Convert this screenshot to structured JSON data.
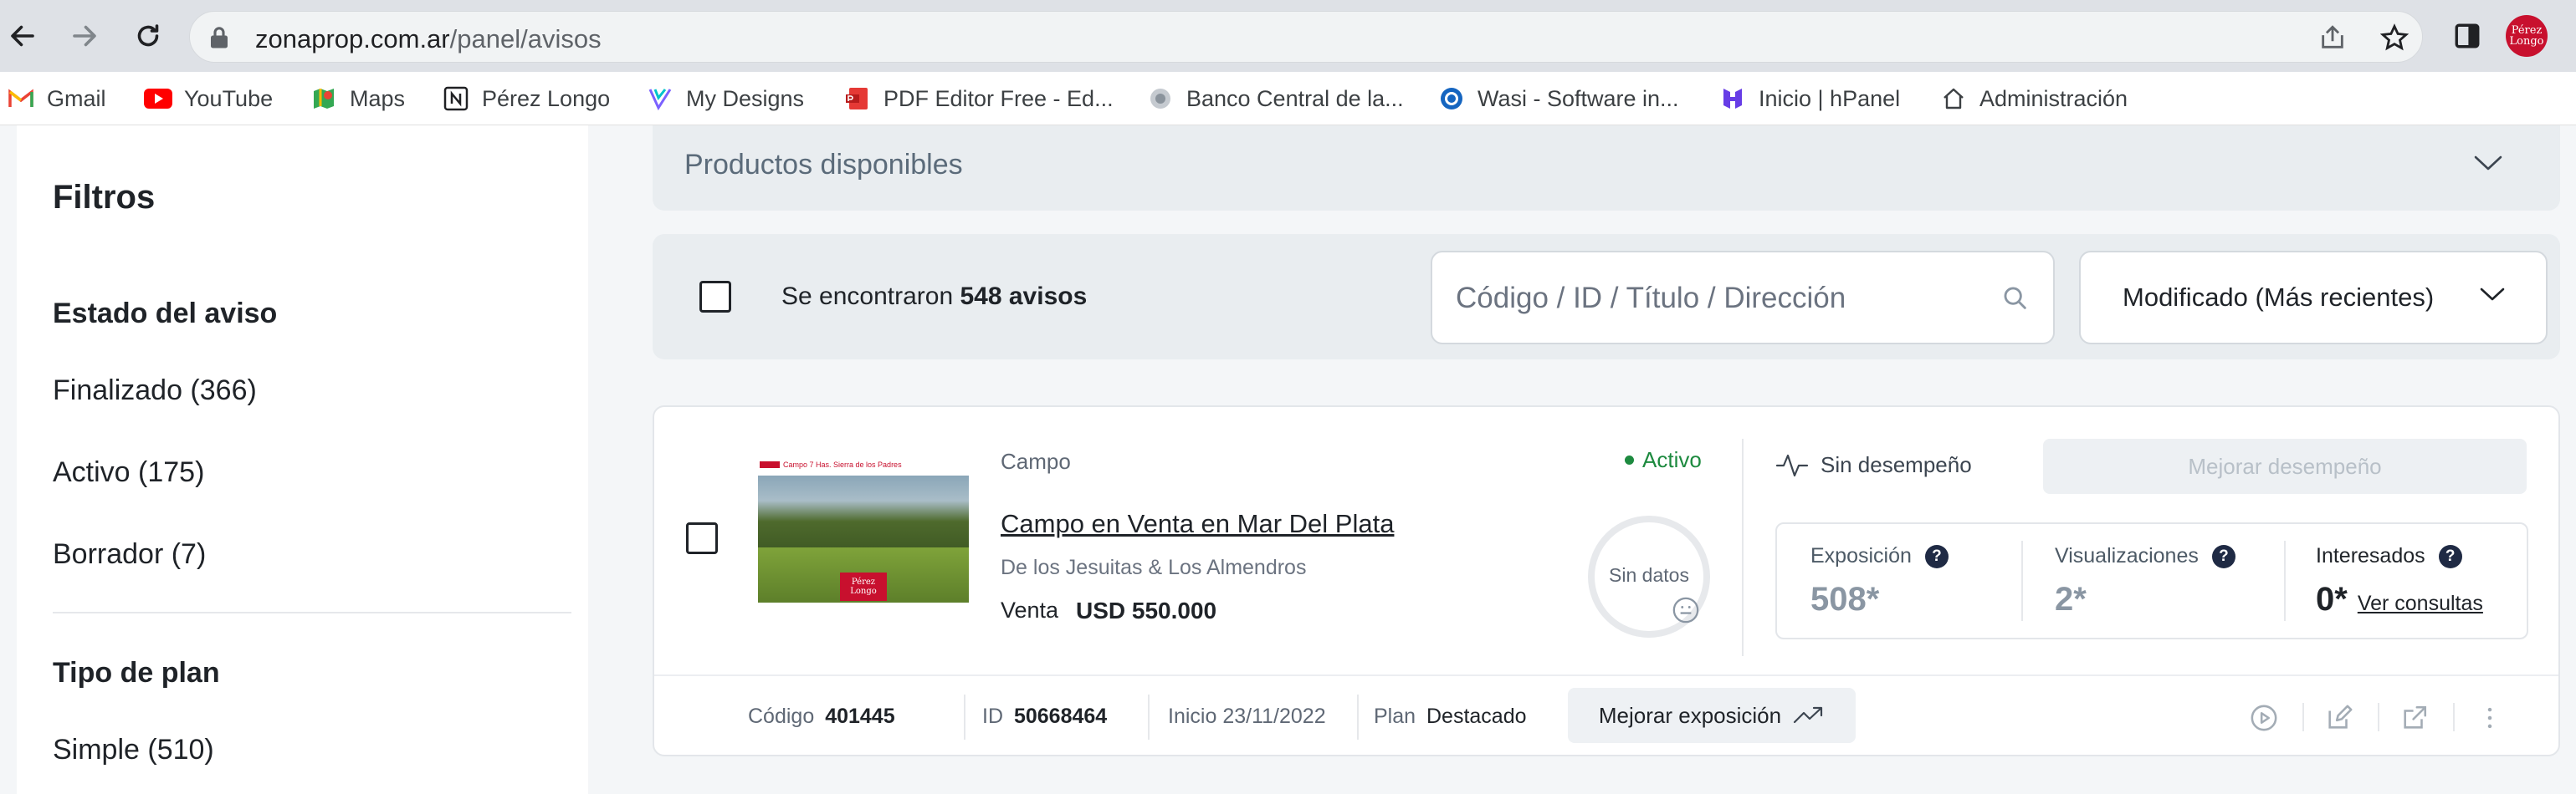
{
  "browser": {
    "url_domain": "zonaprop.com.ar",
    "url_path": "/panel/avisos",
    "profile_label": [
      "Pérez",
      "Longo"
    ]
  },
  "bookmarks": [
    {
      "label": "Gmail",
      "icon": "gmail-icon"
    },
    {
      "label": "YouTube",
      "icon": "youtube-icon"
    },
    {
      "label": "Maps",
      "icon": "maps-icon"
    },
    {
      "label": "Pérez Longo",
      "icon": "notion-icon"
    },
    {
      "label": "My Designs",
      "icon": "designs-icon"
    },
    {
      "label": "PDF Editor Free - Ed...",
      "icon": "pdf-icon"
    },
    {
      "label": "Banco Central de la...",
      "icon": "bank-icon"
    },
    {
      "label": "Wasi - Software in...",
      "icon": "wasi-icon"
    },
    {
      "label": "Inicio | hPanel",
      "icon": "hostinger-icon"
    },
    {
      "label": "Administración",
      "icon": "home-icon"
    }
  ],
  "sidebar": {
    "title": "Filtros",
    "status_heading": "Estado del aviso",
    "status_items": [
      "Finalizado (366)",
      "Activo (175)",
      "Borrador (7)"
    ],
    "plan_heading": "Tipo de plan",
    "plan_items": [
      "Simple (510)"
    ]
  },
  "products_bar": {
    "label": "Productos disponibles"
  },
  "results": {
    "prefix": "Se encontraron",
    "count_text": "548 avisos",
    "search_placeholder": "Código / ID / Título / Dirección",
    "sort_value": "Modificado (Más recientes)"
  },
  "listing": {
    "category": "Campo",
    "title": "Campo en Venta en Mar Del Plata",
    "address": "De los Jesuitas & Los Almendros",
    "operation": "Venta",
    "price": "USD 550.000",
    "status": "Activo",
    "donut_label": "Sin datos",
    "performance": "Sin desempeño",
    "improve_button": "Mejorar desempeño",
    "thumbnail_caption": "Campo 7 Has. Sierra de los Padres",
    "thumbnail_logo": [
      "Pérez",
      "Longo"
    ],
    "stats": [
      {
        "label": "Exposición",
        "value": "508*"
      },
      {
        "label": "Visualizaciones",
        "value": "2*"
      },
      {
        "label": "Interesados",
        "value": "0*",
        "link": "Ver consultas"
      }
    ],
    "footer": {
      "code_label": "Código",
      "code_value": "401445",
      "id_label": "ID",
      "id_value": "50668464",
      "start_label": "Inicio",
      "start_value": "23/11/2022",
      "plan_label": "Plan",
      "plan_value": "Destacado",
      "expo_button": "Mejorar exposición"
    }
  },
  "colors": {
    "active_green": "#1d8a3f",
    "brand_red": "#c8102e",
    "panel_gray": "#e9edf0"
  }
}
